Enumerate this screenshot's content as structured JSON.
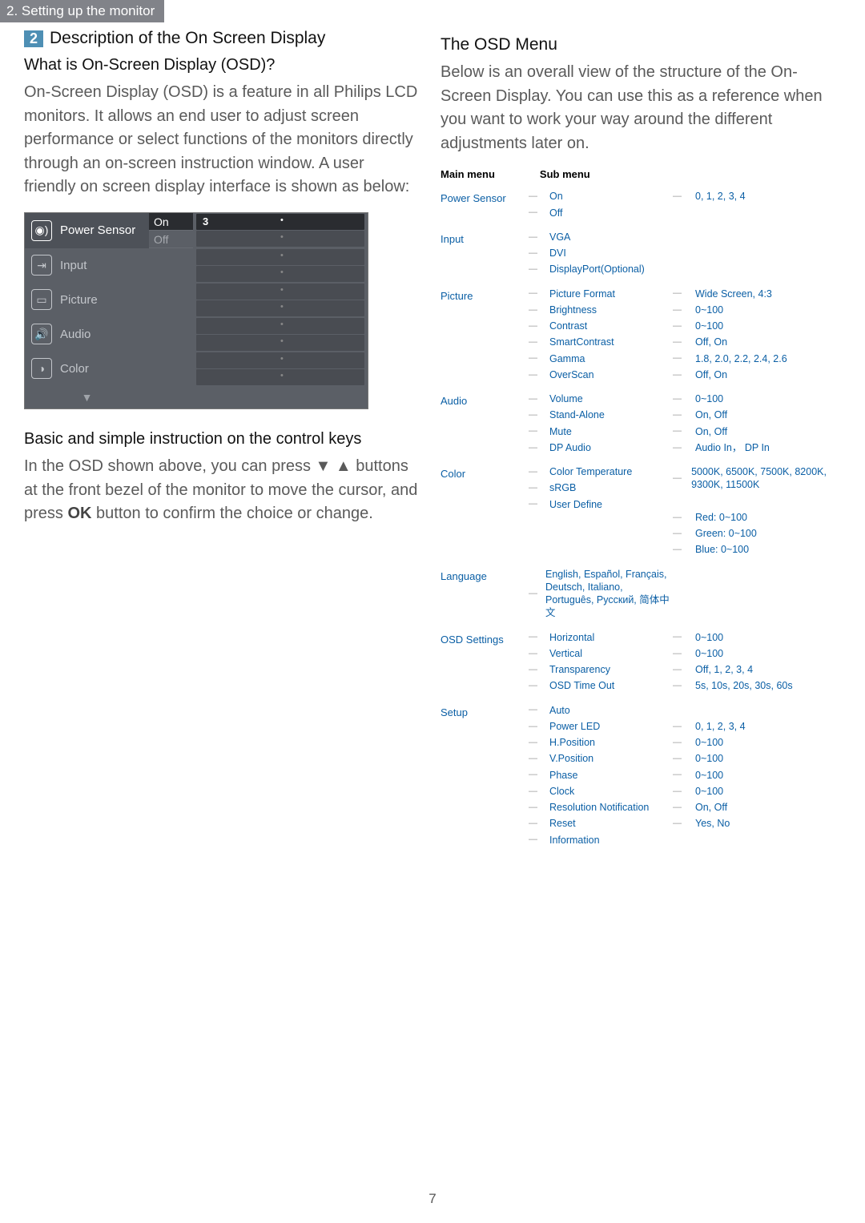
{
  "tab": "2. Setting up the monitor",
  "left": {
    "badge": "2",
    "title": "Description of the On Screen Display",
    "q": "What is On-Screen Display (OSD)?",
    "para": "On-Screen Display (OSD) is a feature in all Philips LCD monitors. It allows an end user to adjust screen performance or select functions of the monitors directly through an on-screen instruction window. A user friendly on screen display interface is shown as below:",
    "basic_h": "Basic and simple instruction on the control keys",
    "basic_p1": "In the OSD shown above, you can press ▼ ▲ buttons at the front bezel of the monitor to move the cursor, and press ",
    "basic_ok": "OK",
    "basic_p2": " button to confirm the choice or change."
  },
  "osd": {
    "items": [
      "Power Sensor",
      "Input",
      "Picture",
      "Audio",
      "Color"
    ],
    "optOn": "On",
    "optOff": "Off",
    "val": "3"
  },
  "right": {
    "title": "The OSD Menu",
    "para": "Below is an overall view of the structure of the On-Screen Display. You can use this as a reference when you want to work your way around the different adjustments later on."
  },
  "tree": {
    "head_main": "Main menu",
    "head_sub": "Sub menu",
    "groups": [
      {
        "main": "Power Sensor",
        "subs": [
          {
            "l": "On",
            "v": "0, 1, 2, 3, 4"
          },
          {
            "l": "Off",
            "v": ""
          }
        ]
      },
      {
        "main": "Input",
        "subs": [
          {
            "l": "VGA",
            "v": ""
          },
          {
            "l": "DVI",
            "v": ""
          },
          {
            "l": "DisplayPort(Optional)",
            "v": ""
          }
        ]
      },
      {
        "main": "Picture",
        "subs": [
          {
            "l": "Picture Format",
            "v": "Wide Screen, 4:3"
          },
          {
            "l": "Brightness",
            "v": "0~100"
          },
          {
            "l": "Contrast",
            "v": "0~100"
          },
          {
            "l": "SmartContrast",
            "v": "Off, On"
          },
          {
            "l": "Gamma",
            "v": "1.8, 2.0, 2.2, 2.4, 2.6"
          },
          {
            "l": "OverScan",
            "v": "Off, On"
          }
        ]
      },
      {
        "main": "Audio",
        "subs": [
          {
            "l": "Volume",
            "v": "0~100"
          },
          {
            "l": "Stand-Alone",
            "v": "On, Off"
          },
          {
            "l": "Mute",
            "v": "On, Off"
          },
          {
            "l": "DP Audio",
            "v": "Audio In， DP In"
          }
        ]
      },
      {
        "main": "Color",
        "subs": [
          {
            "l": "Color Temperature",
            "v": "5000K, 6500K, 7500K, 8200K, 9300K, 11500K"
          },
          {
            "l": "sRGB",
            "v": ""
          },
          {
            "l": "User Define",
            "v": "Red: 0~100"
          },
          {
            "l": "",
            "v": "Green: 0~100"
          },
          {
            "l": "",
            "v": "Blue: 0~100"
          }
        ]
      },
      {
        "main": "Language",
        "subs": [
          {
            "l": "English, Español, Français, Deutsch, Italiano, Português, Русский, 简体中文",
            "v": "",
            "wide": true
          }
        ]
      },
      {
        "main": "OSD Settings",
        "subs": [
          {
            "l": "Horizontal",
            "v": "0~100"
          },
          {
            "l": "Vertical",
            "v": "0~100"
          },
          {
            "l": "Transparency",
            "v": "Off, 1, 2, 3, 4"
          },
          {
            "l": "OSD Time Out",
            "v": "5s, 10s, 20s, 30s, 60s"
          }
        ]
      },
      {
        "main": "Setup",
        "subs": [
          {
            "l": "Auto",
            "v": ""
          },
          {
            "l": "Power LED",
            "v": "0, 1, 2, 3, 4"
          },
          {
            "l": "H.Position",
            "v": "0~100"
          },
          {
            "l": "V.Position",
            "v": "0~100"
          },
          {
            "l": "Phase",
            "v": "0~100"
          },
          {
            "l": "Clock",
            "v": "0~100"
          },
          {
            "l": "Resolution Notification",
            "v": "On, Off"
          },
          {
            "l": "Reset",
            "v": "Yes, No"
          },
          {
            "l": "Information",
            "v": ""
          }
        ]
      }
    ]
  },
  "page_num": "7"
}
